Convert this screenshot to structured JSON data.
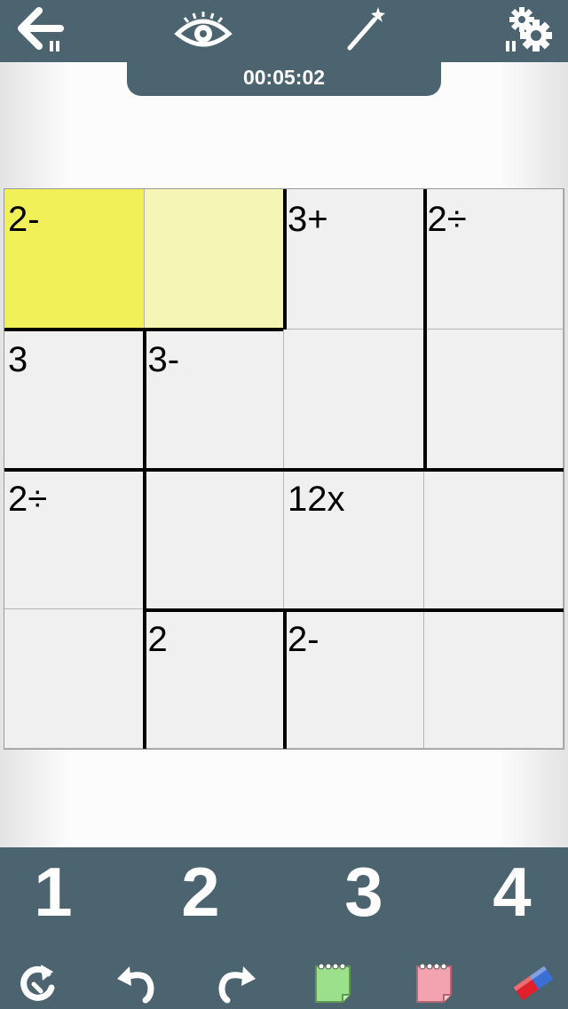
{
  "header": {
    "timer": "00:05:02",
    "icons": {
      "back": "back-arrow-icon",
      "reveal": "eye-icon",
      "hint": "magic-wand-icon",
      "settings": "gear-icon"
    }
  },
  "board": {
    "size": 4,
    "selected_cell": [
      0,
      0
    ],
    "selected_color": "#f2f058",
    "cage_highlight_color": "#f5f5b6",
    "clues": [
      {
        "row": 0,
        "col": 0,
        "text": "2-"
      },
      {
        "row": 0,
        "col": 2,
        "text": "3+"
      },
      {
        "row": 0,
        "col": 3,
        "text": "2÷"
      },
      {
        "row": 1,
        "col": 0,
        "text": "3"
      },
      {
        "row": 1,
        "col": 1,
        "text": "3-"
      },
      {
        "row": 2,
        "col": 0,
        "text": "2÷"
      },
      {
        "row": 2,
        "col": 2,
        "text": "12x"
      },
      {
        "row": 3,
        "col": 1,
        "text": "2"
      },
      {
        "row": 3,
        "col": 2,
        "text": "2-"
      }
    ]
  },
  "keypad": {
    "numbers": [
      "1",
      "2",
      "3",
      "4"
    ]
  },
  "toolbar": {
    "icons": [
      "restart-icon",
      "undo-icon",
      "redo-icon",
      "notes-green-icon",
      "notes-red-icon",
      "eraser-icon"
    ]
  },
  "colors": {
    "bar": "#4b6470",
    "notes_green": "#9be08a",
    "notes_red": "#f3a3b0",
    "eraser": "#e0202a"
  }
}
